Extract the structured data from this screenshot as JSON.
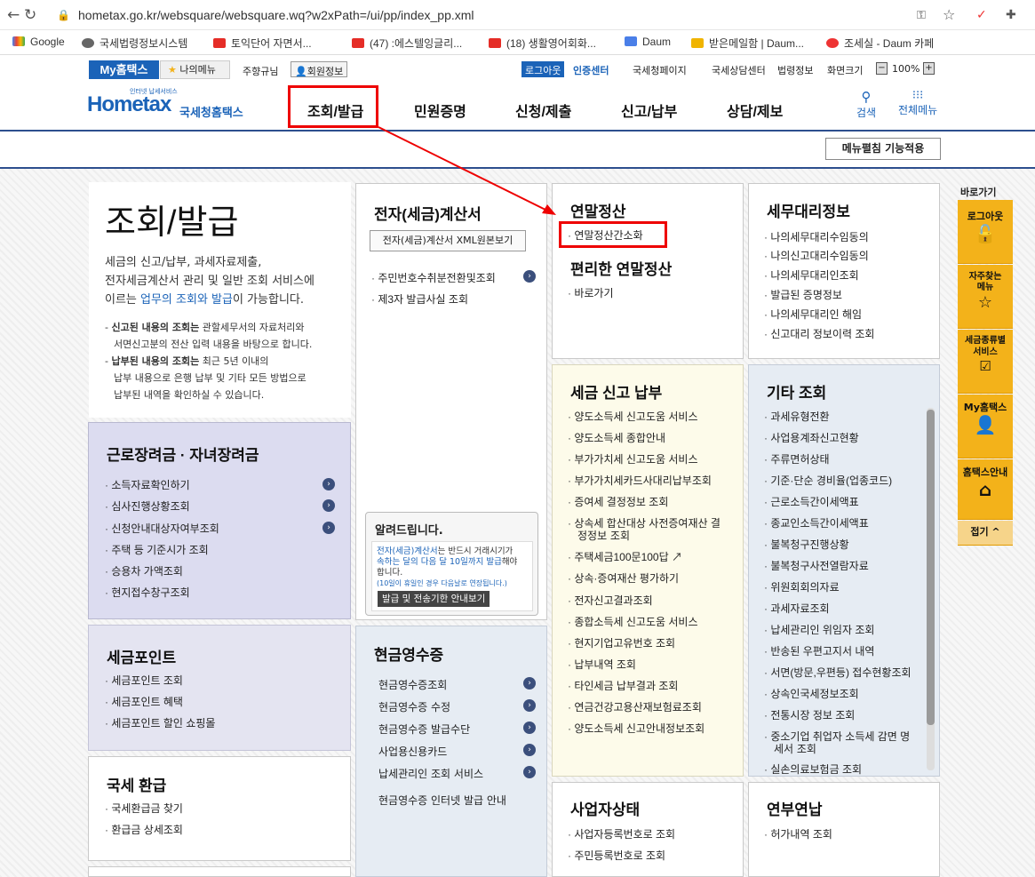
{
  "browser": {
    "url": "hometax.go.kr/websquare/websquare.wq?w2xPath=/ui/pp/index_pp.xml",
    "bookmarks": [
      "Google",
      "국세법령정보시스템",
      "토익단어 자면서...",
      "(47) :에스텔잉글리...",
      "(18) 생활영어회화...",
      "Daum",
      "받은메일함 | Daum...",
      "조세실 - Daum 카페"
    ]
  },
  "util": {
    "my": "My홈택스",
    "mymenu": "나의메뉴",
    "user": "주향규님",
    "member": "회원정보",
    "logout": "로그아웃",
    "cert": "인증센터",
    "links": [
      "국세청페이지",
      "국세상담센터",
      "법령정보",
      "화면크기"
    ],
    "zoom": "100%"
  },
  "header": {
    "logo_small": "인터넷 납세서비스",
    "logo_main": "Hometax",
    "logo_sub": "국세청홈택스",
    "nav": [
      "조회/발급",
      "민원증명",
      "신청/제출",
      "신고/납부",
      "상담/제보"
    ],
    "search": "검색",
    "allmenu": "전체메뉴",
    "menu_apply": "메뉴펼침 기능적용"
  },
  "intro": {
    "title": "조회/발급",
    "desc1": "세금의 신고/납부, 과세자료제출,",
    "desc2": "전자세금계산서 관리 및 일반 조회 서비스에",
    "desc3a": "이르는 ",
    "desc3b": "업무의 조회와 발급",
    "desc3c": "이 가능합니다.",
    "n1a": "신고된 내용의 조회는",
    "n1b": " 관할세무서의 자료처리와",
    "n1c": "서면신고분의 전산 입력 내용을 바탕으로 합니다.",
    "n2a": "납부된 내용의 조회는",
    "n2b": " 최근 5년 이내의",
    "n2c": "납부 내용으로 은행 납부 및 기타 모든 방법으로",
    "n2d": "납부된 내역을 확인하실 수 있습니다."
  },
  "labor": {
    "title": "근로장려금 · 자녀장려금",
    "items": [
      "소득자료확인하기",
      "심사진행상황조회",
      "신청안내대상자여부조회",
      "주택 등 기준시가 조회",
      "승용차 가액조회",
      "현지접수창구조회"
    ]
  },
  "point": {
    "title": "세금포인트",
    "items": [
      "세금포인트 조회",
      "세금포인트 혜택",
      "세금포인트 할인 쇼핑몰"
    ]
  },
  "refund": {
    "title": "국세 환급",
    "items": [
      "국세환급금 찾기",
      "환급금 상세조회"
    ]
  },
  "einvoice": {
    "title": "전자(세금)계산서",
    "btn": "전자(세금)계산서 XML원본보기",
    "items": [
      "주민번호수취분전환및조회",
      "제3자 발급사실 조회"
    ],
    "notice_title": "알려드립니다.",
    "notice_a": "전자(세금)계산서",
    "notice_b": "는 반드시 거래시기가",
    "notice_c": "속하는 달의 다음 달 10일까지 발급",
    "notice_d": "해야",
    "notice_e": "합니다.",
    "notice_f": "(10일이 휴일인 경우 다음날로 연장됩니다.)",
    "notice_btn": "발급 및 전송기한 안내보기"
  },
  "cash": {
    "title": "현금영수증",
    "items": [
      "현금영수증조회",
      "현금영수증 수정",
      "현금영수증 발급수단",
      "사업용신용카드",
      "납세관리인 조회 서비스"
    ],
    "extra": "현금영수증 인터넷 발급 안내"
  },
  "yearend": {
    "title": "연말정산",
    "item": "연말정산간소화",
    "title2": "편리한 연말정산",
    "item2": "바로가기"
  },
  "taxpay": {
    "title": "세금 신고 납부",
    "items": [
      "양도소득세 신고도움 서비스",
      "양도소득세 종합안내",
      "부가가치세 신고도움 서비스",
      "부가가치세카드사대리납부조회",
      "증여세 결정정보 조회",
      "상속세 합산대상 사전증여재산 결",
      "정정보 조회",
      "주택세금100문100답",
      "상속·증여재산 평가하기",
      "전자신고결과조회",
      "종합소득세 신고도움 서비스",
      "현지기업고유번호 조회",
      "납부내역 조회",
      "타인세금 납부결과 조회",
      "연금건강고용산재보험료조회",
      "양도소득세 신고안내정보조회"
    ]
  },
  "bizstatus": {
    "title": "사업자상태",
    "items": [
      "사업자등록번호로 조회",
      "주민등록번호로 조회"
    ]
  },
  "agent": {
    "title": "세무대리정보",
    "items": [
      "나의세무대리수임동의",
      "나의신고대리수임동의",
      "나의세무대리인조회",
      "발급된 증명정보",
      "나의세무대리인 해임",
      "신고대리 정보이력 조회"
    ]
  },
  "etc": {
    "title": "기타 조회",
    "items": [
      "과세유형전환",
      "사업용계좌신고현황",
      "주류면허상태",
      "기준·단순 경비율(업종코드)",
      "근로소득간이세액표",
      "종교인소득간이세액표",
      "불복청구진행상황",
      "불복청구사전열람자료",
      "위원회회의자료",
      "과세자료조회",
      "납세관리인 위임자 조회",
      "반송된 우편고지서 내역",
      "서면(방문,우편등) 접수현황조회",
      "상속인국세정보조회",
      "전통시장 정보 조회",
      "중소기업 취업자 소득세 감면 명",
      "세서 조회",
      "실손의료보험금 조회"
    ]
  },
  "pension": {
    "title": "연부연납",
    "items": [
      "허가내역 조회"
    ]
  },
  "quick": {
    "title": "바로가기",
    "items": [
      "로그아웃",
      "자주찾는 메뉴",
      "세금종류별 서비스",
      "My홈택스",
      "홈택스안내"
    ],
    "fold": "접기 ^"
  }
}
